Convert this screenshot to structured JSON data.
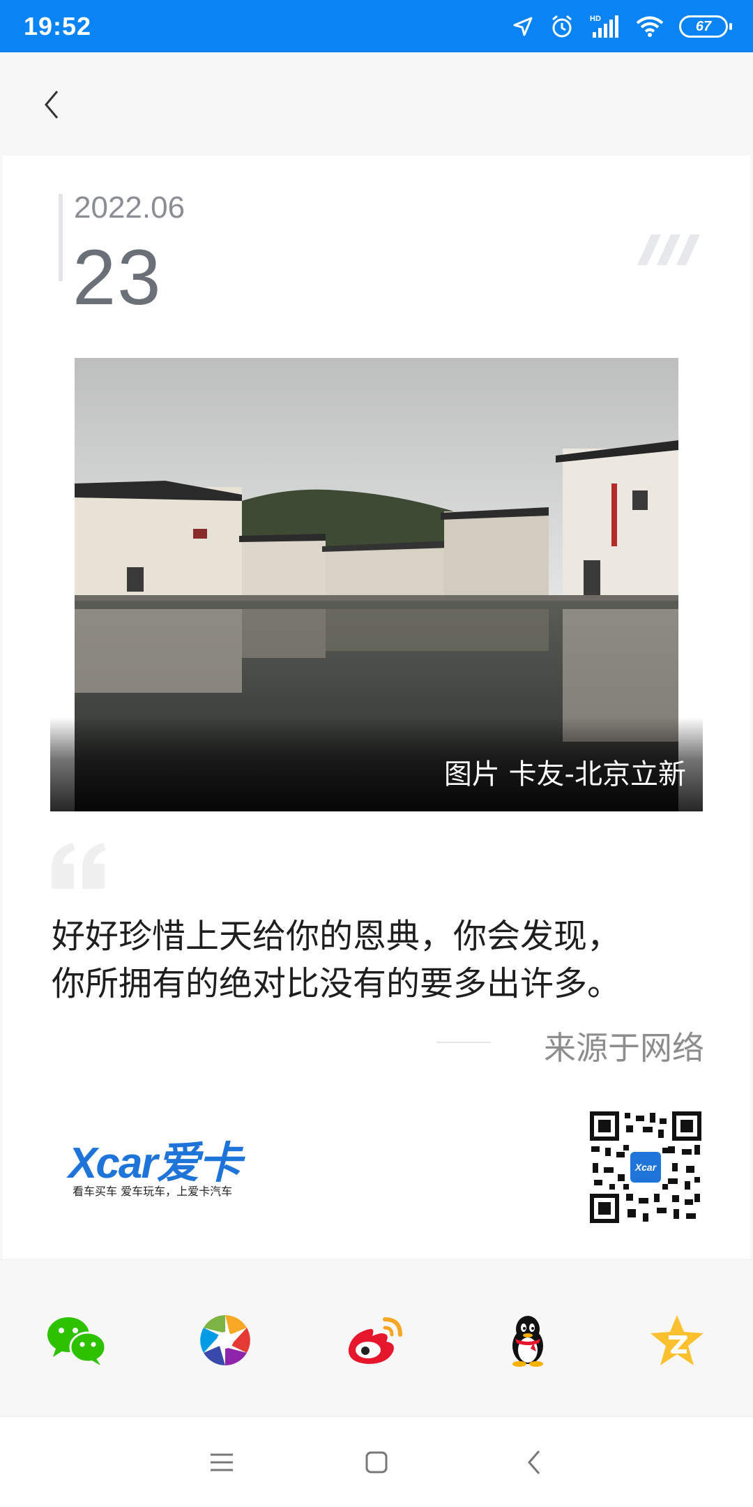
{
  "status_bar": {
    "time": "19:52",
    "battery": "67"
  },
  "card": {
    "date_month": "2022.06",
    "date_day": "23",
    "photo_caption": "图片 卡友-北京立新",
    "quote_lines": [
      "好好珍惜上天给你的恩典，你会发现，",
      "你所拥有的绝对比没有的要多出许多。"
    ],
    "source": "来源于网络",
    "logo": {
      "text": "Xcar爱卡",
      "slogan": "看车买车 爱车玩车，上爱卡汽车"
    },
    "qr_center_label": "Xcar"
  },
  "share": [
    {
      "name": "wechat",
      "icon": "wechat-icon"
    },
    {
      "name": "moments",
      "icon": "moments-icon"
    },
    {
      "name": "weibo",
      "icon": "weibo-icon"
    },
    {
      "name": "qq",
      "icon": "qq-icon"
    },
    {
      "name": "qzone",
      "icon": "qzone-icon"
    }
  ],
  "colors": {
    "status_bar": "#0a84f4",
    "brand": "#1e74d9",
    "page_bg": "#f7f7f7"
  }
}
